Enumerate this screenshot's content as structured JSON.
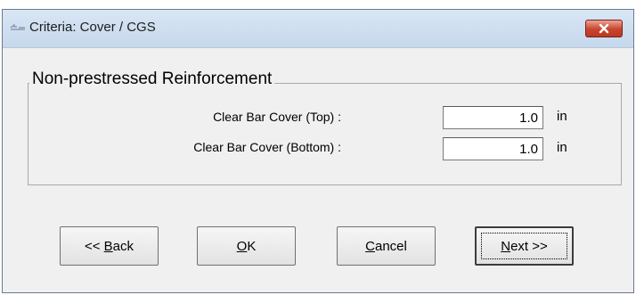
{
  "window": {
    "title": "Criteria: Cover / CGS"
  },
  "group": {
    "legend": "Non-prestressed Reinforcement"
  },
  "fields": [
    {
      "label": "Clear Bar Cover (Top) :",
      "value": "1.0",
      "unit": "in"
    },
    {
      "label": "Clear Bar Cover (Bottom) :",
      "value": "1.0",
      "unit": "in"
    }
  ],
  "buttons": {
    "back": {
      "pre": "<< ",
      "mnemonic": "B",
      "rest": "ack"
    },
    "ok": {
      "pre": "",
      "mnemonic": "O",
      "rest": "K"
    },
    "cancel": {
      "pre": "",
      "mnemonic": "C",
      "rest": "ancel"
    },
    "next": {
      "pre": "",
      "mnemonic": "N",
      "rest": "ext >>"
    }
  },
  "colors": {
    "titlebar": "#c6d8ec",
    "close_button": "#c9442c",
    "dialog_bg": "#f0f0f0"
  }
}
